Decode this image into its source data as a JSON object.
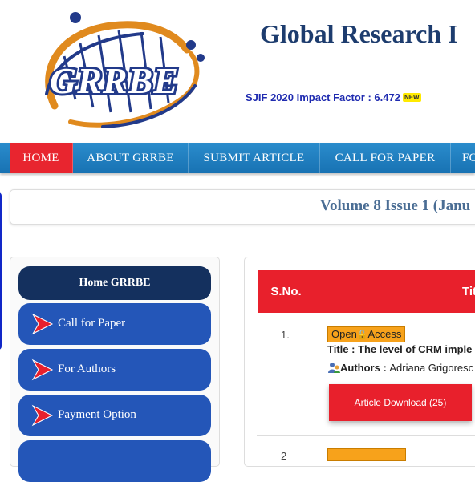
{
  "header": {
    "logo_text": "GRRBE",
    "site_title": "Global Research I",
    "impact_factor": "SJIF 2020 Impact Factor : 6.472",
    "new_badge": "NEW"
  },
  "nav": {
    "items": [
      {
        "label": "HOME"
      },
      {
        "label": "ABOUT GRRBE"
      },
      {
        "label": "SUBMIT ARTICLE"
      },
      {
        "label": "CALL FOR PAPER"
      },
      {
        "label": "FO"
      }
    ]
  },
  "volume": {
    "text": "Volume 8 Issue 1 (Janu"
  },
  "sidebar": {
    "home": "Home GRRBE",
    "items": [
      {
        "label": "Call for Paper"
      },
      {
        "label": "For Authors"
      },
      {
        "label": "Payment Option"
      },
      {
        "label": ""
      }
    ]
  },
  "table": {
    "headers": {
      "sno": "S.No.",
      "title": "Tit"
    },
    "rows": [
      {
        "sno": "1.",
        "open": "Open",
        "access": "Access",
        "title_label": "Title : ",
        "title": "The level of CRM imple",
        "authors_label": "Authors : ",
        "authors": "Adriana Grigoresc",
        "download": "Article Download (25)"
      },
      {
        "sno": "2"
      }
    ]
  },
  "colors": {
    "nav_blue": "#1f80c0",
    "accent_red": "#e8202c",
    "sidebar_blue": "#2456b8",
    "sidebar_dark": "#14305e",
    "title_navy": "#1d3c6e",
    "open_access_orange": "#f7a21b"
  }
}
